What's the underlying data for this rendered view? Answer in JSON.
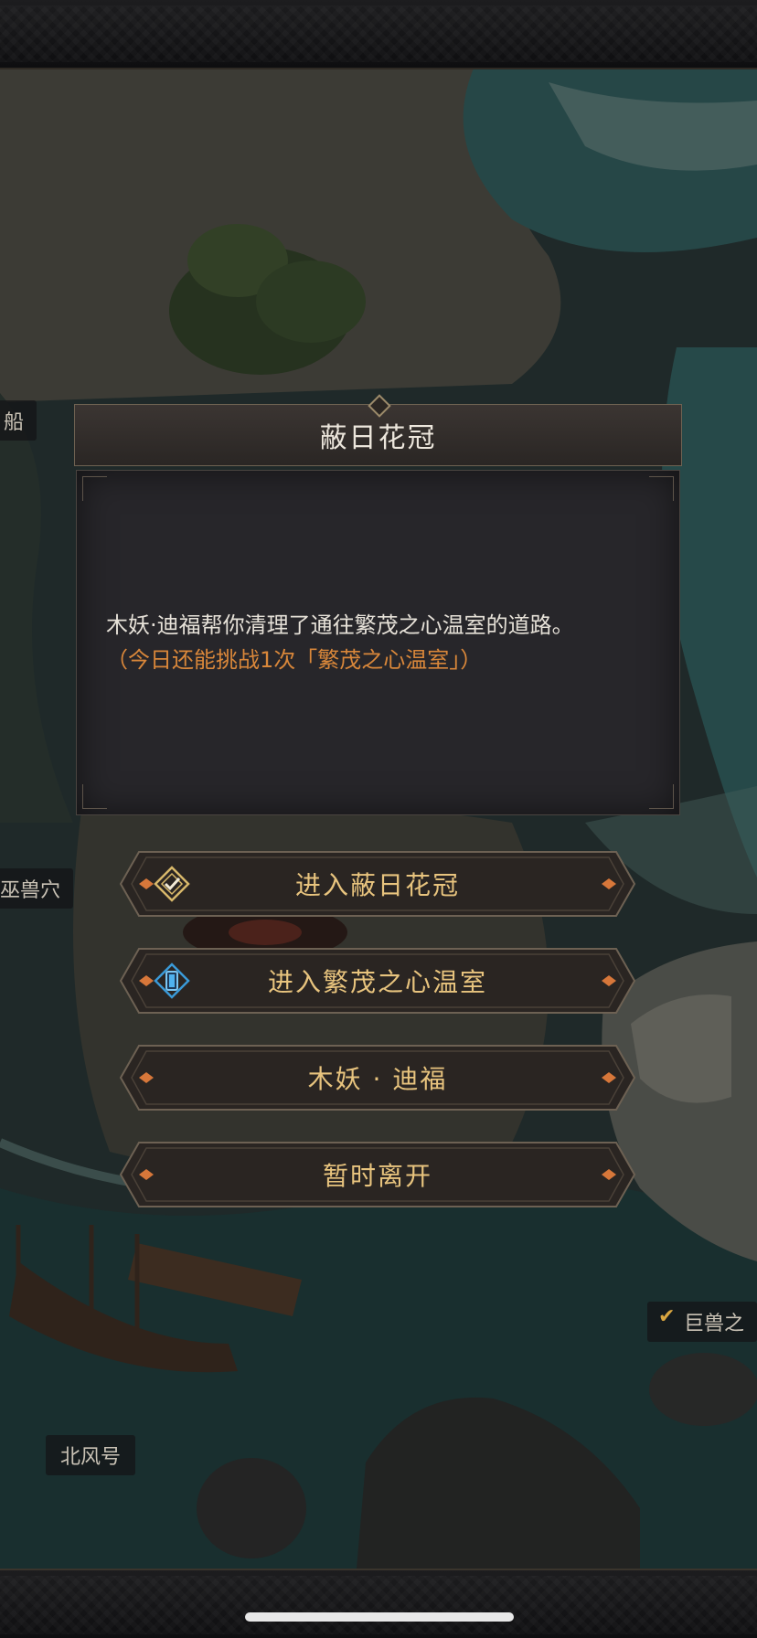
{
  "map": {
    "labels": [
      {
        "id": "ship",
        "text": "船"
      },
      {
        "id": "beast-cave",
        "text": "巫兽穴"
      },
      {
        "id": "giant-beast",
        "text": "巨兽之"
      },
      {
        "id": "north-wind",
        "text": "北风号"
      }
    ]
  },
  "dialog": {
    "title": "蔽日花冠",
    "body_text": "木妖·迪福帮你清理了通往繁茂之心温室的道路。",
    "body_note": "（今日还能挑战1次「繁茂之心温室」）"
  },
  "options": [
    {
      "label": "进入蔽日花冠",
      "icon": "checked-diamond-icon"
    },
    {
      "label": "进入繁茂之心温室",
      "icon": "blue-crystal-icon"
    },
    {
      "label": "木妖 · 迪福",
      "icon": ""
    },
    {
      "label": "暂时离开",
      "icon": ""
    }
  ],
  "colors": {
    "accent_orange": "#d9873a",
    "button_text": "#e8c47e",
    "title_text": "#ece6dc"
  }
}
